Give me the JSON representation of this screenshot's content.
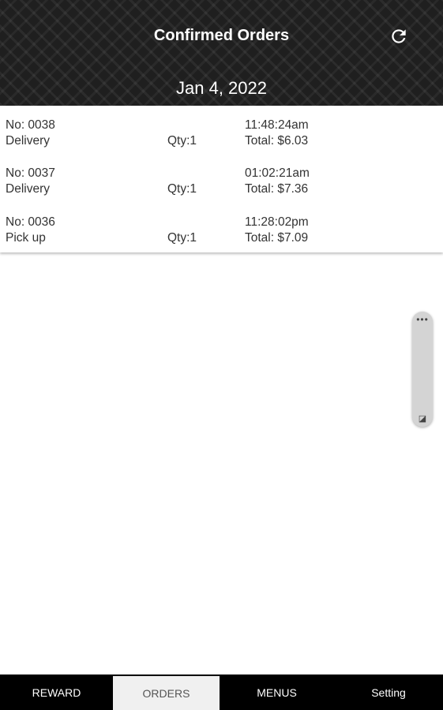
{
  "header": {
    "title": "Confirmed Orders",
    "date": "Jan 4, 2022",
    "refresh_icon": "refresh-icon"
  },
  "orders": [
    {
      "number": "No: 0038",
      "type": "Delivery",
      "qty": "Qty:1",
      "time": "11:48:24am",
      "total": "Total: $6.03"
    },
    {
      "number": "No: 0037",
      "type": "Delivery",
      "qty": "Qty:1",
      "time": "01:02:21am",
      "total": "Total: $7.36"
    },
    {
      "number": "No: 0036",
      "type": "Pick up",
      "qty": "Qty:1",
      "time": "11:28:02pm",
      "total": "Total: $7.09"
    }
  ],
  "floating_panel": {
    "menu_icon": "ellipsis-icon",
    "bottom_icon": "resize-icon"
  },
  "nav": {
    "items": [
      {
        "label": "REWARD",
        "active": false
      },
      {
        "label": "ORDERS",
        "active": true
      },
      {
        "label": "MENUS",
        "active": false
      },
      {
        "label": "Setting",
        "active": false
      }
    ]
  },
  "colors": {
    "header_bg": "#1f1f1f",
    "navbar_bg": "#000000",
    "active_tab_bg": "#f0f0f0"
  }
}
